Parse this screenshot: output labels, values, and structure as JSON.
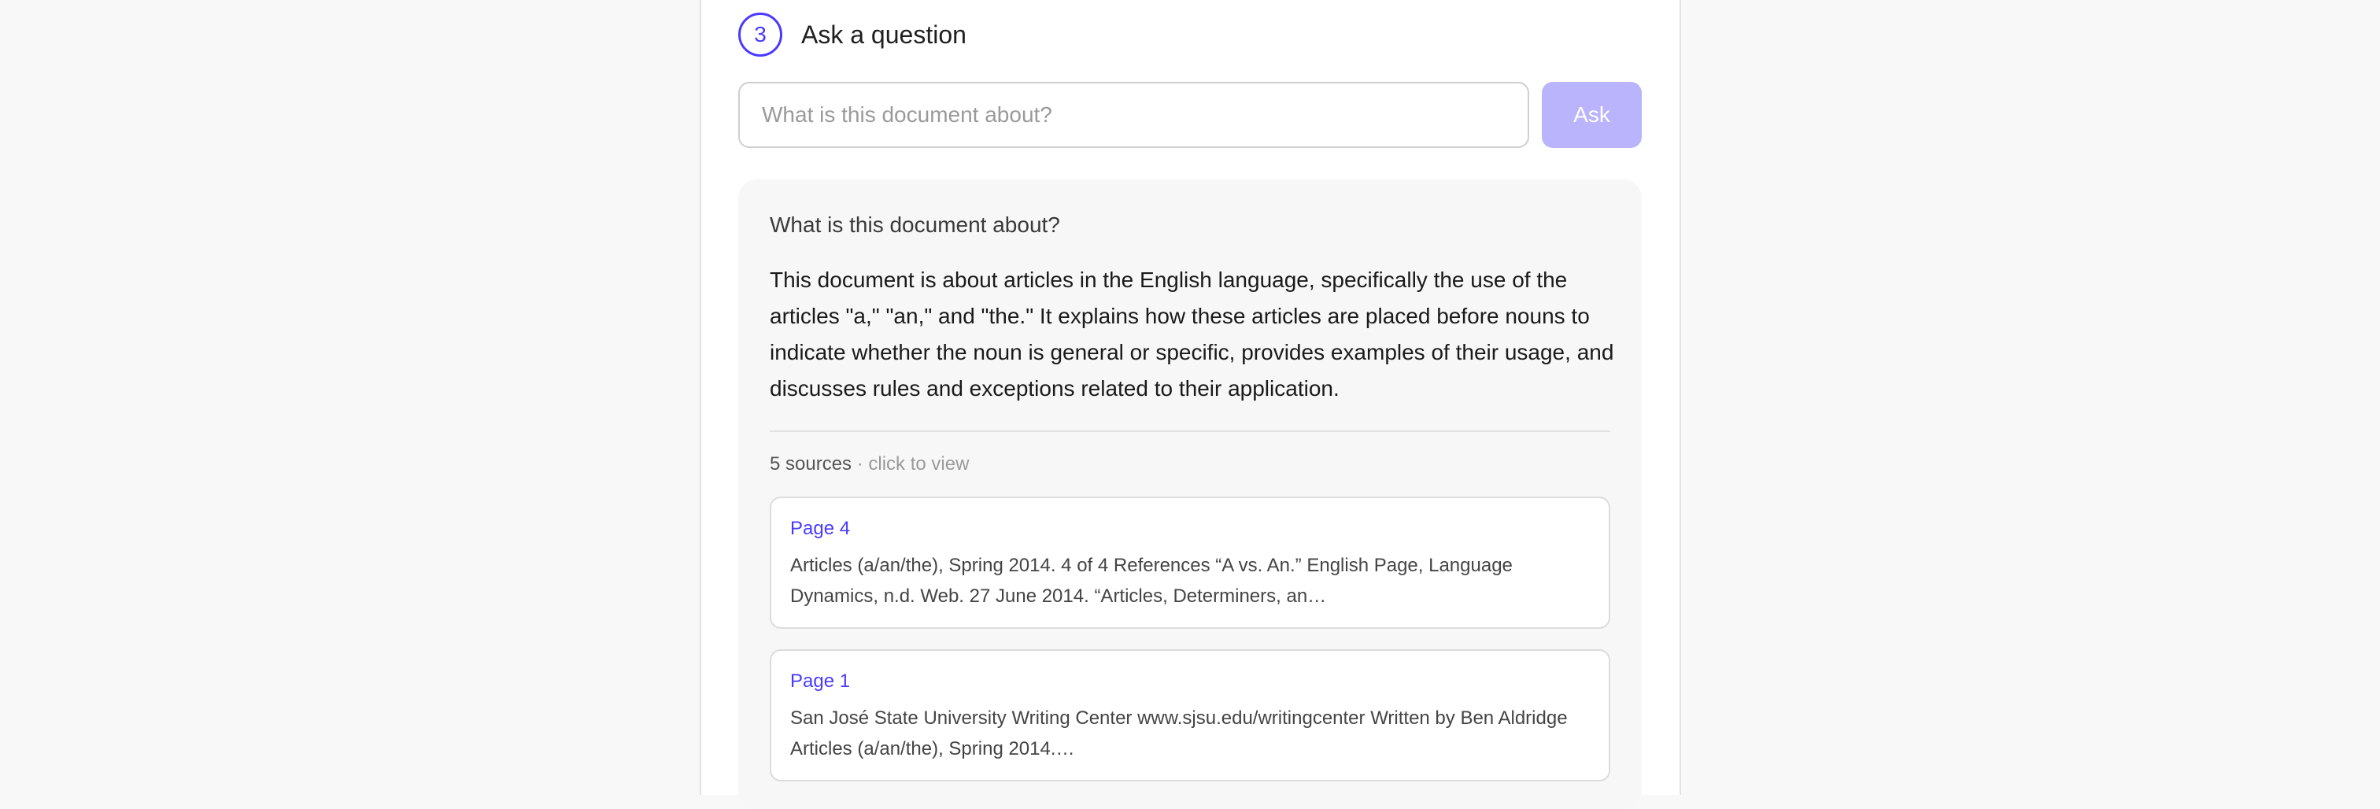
{
  "step": {
    "number": "3",
    "title": "Ask a question"
  },
  "ask": {
    "placeholder": "What is this document about?",
    "value": "",
    "button_label": "Ask"
  },
  "answer": {
    "question": "What is this document about?",
    "text": "This document is about articles in the English language, specifically the use of the articles \"a,\" \"an,\" and \"the.\" It explains how these articles are placed before nouns to indicate whether the noun is general or specific, provides examples of their usage, and discusses rules and exceptions related to their application."
  },
  "sources": {
    "count_label": "5 sources",
    "hint": " · click to view",
    "items": [
      {
        "page": "Page 4",
        "snippet": "Articles (a/an/the), Spring 2014. 4 of 4 References “A vs. An.” English Page, Language Dynamics, n.d. Web. 27 June 2014. “Articles, Determiners, an…"
      },
      {
        "page": "Page 1",
        "snippet": "San José State University Writing Center www.sjsu.edu/writingcenter Written by Ben Aldridge Articles (a/an/the), Spring 2014.…"
      }
    ]
  },
  "colors": {
    "accent": "#4a3aff",
    "button_disabled": "#b9b4fb",
    "card_background": "#f7f7f7"
  }
}
